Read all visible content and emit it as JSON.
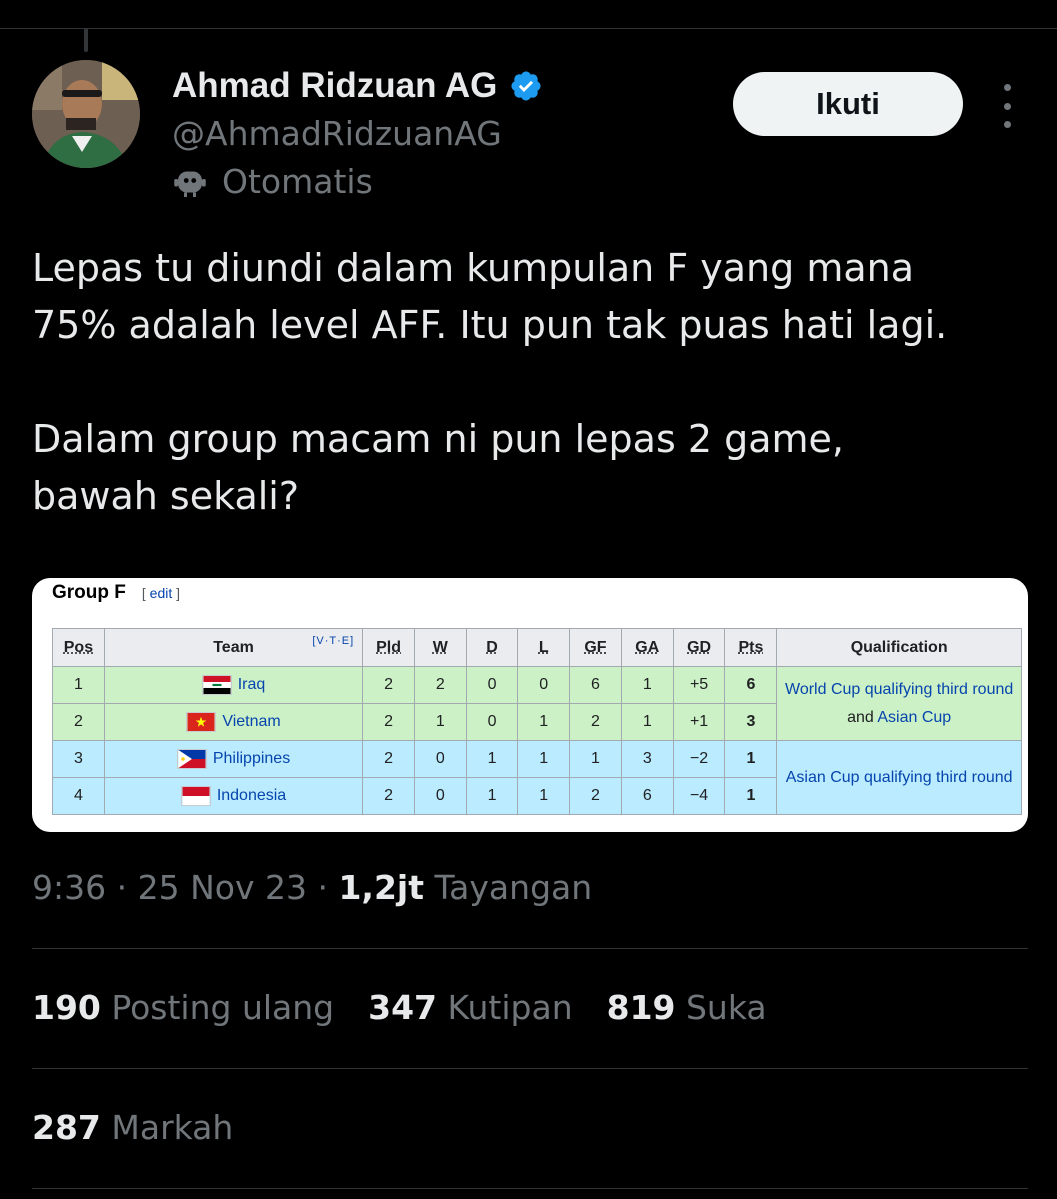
{
  "author": {
    "name": "Ahmad Ridzuan AG",
    "handle": "@AhmadRidzuanAG",
    "automated_label": "Otomatis",
    "verified_color": "#1d9bf0"
  },
  "follow_label": "Ikuti",
  "tweet": {
    "lines_p1": [
      "Lepas tu diundi dalam kumpulan F yang mana",
      "75% adalah level AFF. Itu pun tak puas hati lagi."
    ],
    "lines_p2": [
      "Dalam group macam ni pun lepas 2 game,",
      "bawah sekali?"
    ]
  },
  "media": {
    "heading": "Group F",
    "edit_open": "[ ",
    "edit_label": "edit",
    "edit_close": " ]",
    "vte": "[V·T·E]",
    "headers": [
      "Pos",
      "Team",
      "Pld",
      "W",
      "D",
      "L",
      "GF",
      "GA",
      "GD",
      "Pts",
      "Qualification"
    ],
    "rows": [
      {
        "pos": "1",
        "team": "Iraq",
        "pld": "2",
        "w": "2",
        "d": "0",
        "l": "0",
        "gf": "6",
        "ga": "1",
        "gd": "+5",
        "pts": "6"
      },
      {
        "pos": "2",
        "team": "Vietnam",
        "pld": "2",
        "w": "1",
        "d": "0",
        "l": "1",
        "gf": "2",
        "ga": "1",
        "gd": "+1",
        "pts": "3"
      },
      {
        "pos": "3",
        "team": "Philippines",
        "pld": "2",
        "w": "0",
        "d": "1",
        "l": "1",
        "gf": "1",
        "ga": "3",
        "gd": "−2",
        "pts": "1"
      },
      {
        "pos": "4",
        "team": "Indonesia",
        "pld": "2",
        "w": "0",
        "d": "1",
        "l": "1",
        "gf": "2",
        "ga": "6",
        "gd": "−4",
        "pts": "1"
      }
    ],
    "qualification_a": {
      "link1": "World Cup qualifying third round",
      "and": " and ",
      "link2": "Asian Cup"
    },
    "qualification_b": "Asian Cup qualifying third round",
    "qual_color_a": "#ccf1c7",
    "qual_color_b": "#bbebff"
  },
  "meta": {
    "time": "9:36",
    "sep": " · ",
    "date": "25 Nov 23",
    "views_count": "1,2jt",
    "views_label": " Tayangan"
  },
  "stats": {
    "reposts_count": "190",
    "reposts_label": " Posting ulang",
    "quotes_count": "347",
    "quotes_label": " Kutipan",
    "likes_count": "819",
    "likes_label": " Suka",
    "bookmarks_count": "287",
    "bookmarks_label": " Markah"
  }
}
